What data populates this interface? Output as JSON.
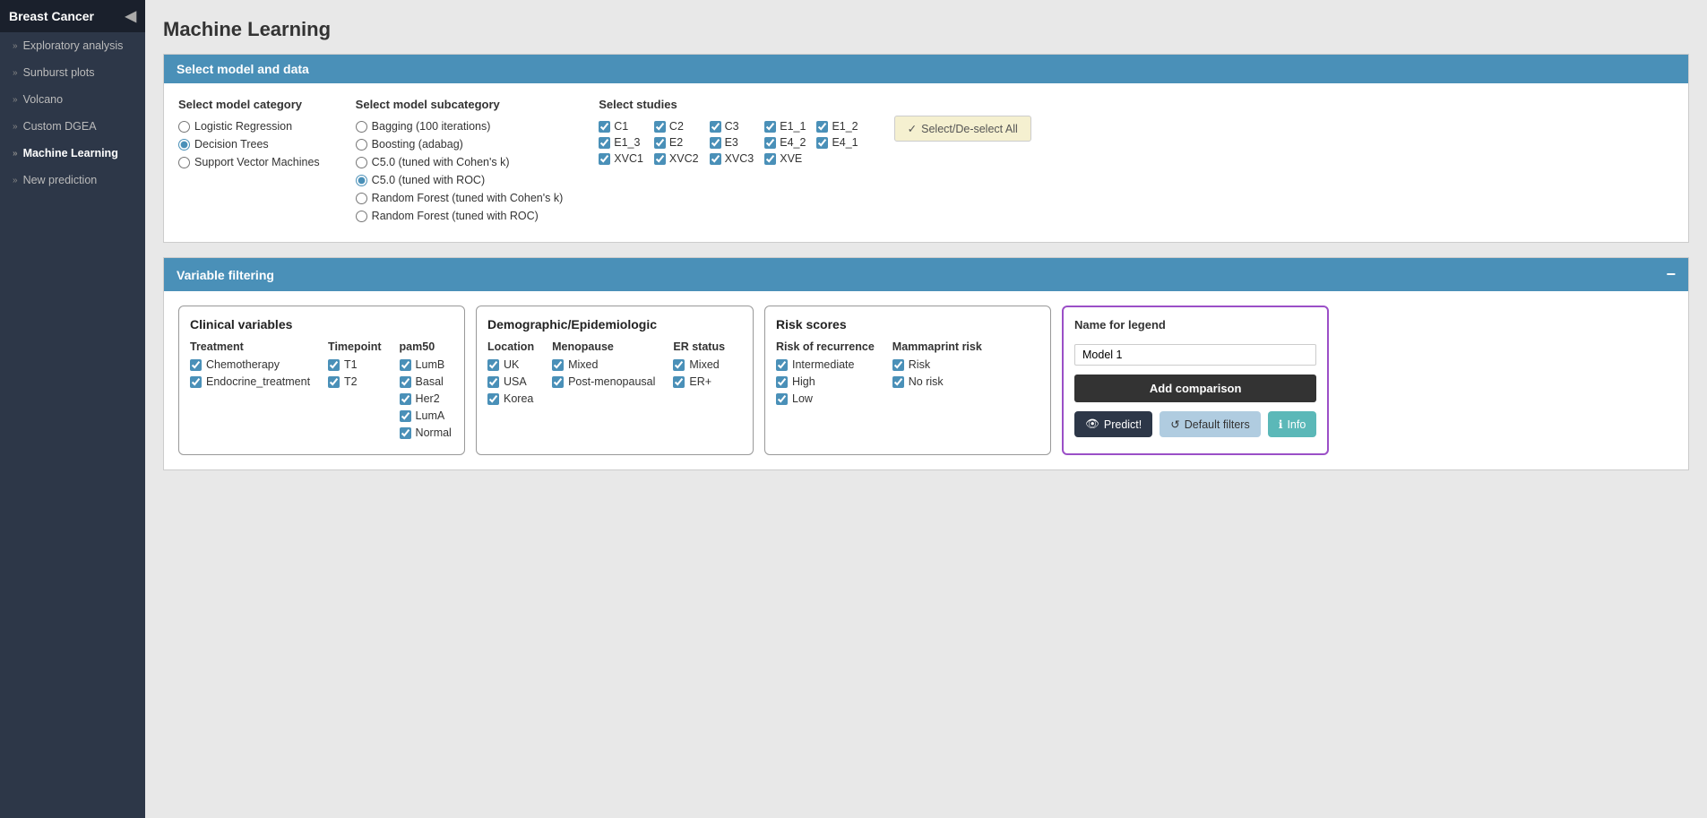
{
  "app": {
    "title": "Breast Cancer",
    "toggle_icon": "◀"
  },
  "sidebar": {
    "items": [
      {
        "id": "exploratory-analysis",
        "label": "Exploratory analysis",
        "active": false
      },
      {
        "id": "sunburst-plots",
        "label": "Sunburst plots",
        "active": false
      },
      {
        "id": "volcano",
        "label": "Volcano",
        "active": false
      },
      {
        "id": "custom-dgea",
        "label": "Custom DGEA",
        "active": false
      },
      {
        "id": "machine-learning",
        "label": "Machine Learning",
        "active": true
      },
      {
        "id": "new-prediction",
        "label": "New prediction",
        "active": false
      }
    ]
  },
  "page_title": "Machine Learning",
  "model_selection": {
    "panel_title": "Select model and data",
    "model_category": {
      "label": "Select model category",
      "options": [
        {
          "id": "logistic",
          "label": "Logistic Regression",
          "checked": false
        },
        {
          "id": "decision-trees",
          "label": "Decision Trees",
          "checked": true
        },
        {
          "id": "svm",
          "label": "Support Vector Machines",
          "checked": false
        }
      ]
    },
    "model_subcategory": {
      "label": "Select model subcategory",
      "options": [
        {
          "id": "bagging",
          "label": "Bagging (100 iterations)",
          "checked": false
        },
        {
          "id": "boosting",
          "label": "Boosting (adabag)",
          "checked": false
        },
        {
          "id": "c50-cohens",
          "label": "C5.0 (tuned with Cohen's k)",
          "checked": false
        },
        {
          "id": "c50-roc",
          "label": "C5.0 (tuned with ROC)",
          "checked": true
        },
        {
          "id": "rf-cohens",
          "label": "Random Forest (tuned with Cohen's k)",
          "checked": false
        },
        {
          "id": "rf-roc",
          "label": "Random Forest (tuned with ROC)",
          "checked": false
        }
      ]
    },
    "studies": {
      "label": "Select studies",
      "items": [
        {
          "id": "C1",
          "label": "C1",
          "checked": true
        },
        {
          "id": "C2",
          "label": "C2",
          "checked": true
        },
        {
          "id": "C3",
          "label": "C3",
          "checked": true
        },
        {
          "id": "E1_1",
          "label": "E1_1",
          "checked": true
        },
        {
          "id": "E1_2",
          "label": "E1_2",
          "checked": true
        },
        {
          "id": "E1_3",
          "label": "E1_3",
          "checked": true
        },
        {
          "id": "E2",
          "label": "E2",
          "checked": true
        },
        {
          "id": "E3",
          "label": "E3",
          "checked": true
        },
        {
          "id": "E4_2",
          "label": "E4_2",
          "checked": true
        },
        {
          "id": "E4_1",
          "label": "E4_1",
          "checked": true
        },
        {
          "id": "XVC1",
          "label": "XVC1",
          "checked": true
        },
        {
          "id": "XVC2",
          "label": "XVC2",
          "checked": true
        },
        {
          "id": "XVC3",
          "label": "XVC3",
          "checked": true
        },
        {
          "id": "XVE",
          "label": "XVE",
          "checked": true
        }
      ],
      "btn_label": "Select/De-select All",
      "btn_check_icon": "✓"
    }
  },
  "variable_filtering": {
    "panel_title": "Variable filtering",
    "collapse_icon": "−",
    "clinical": {
      "title": "Clinical variables",
      "treatment": {
        "header": "Treatment",
        "items": [
          {
            "label": "Chemotherapy",
            "checked": true
          },
          {
            "label": "Endocrine_treatment",
            "checked": true
          }
        ]
      },
      "timepoint": {
        "header": "Timepoint",
        "items": [
          {
            "label": "T1",
            "checked": true
          },
          {
            "label": "T2",
            "checked": true
          }
        ]
      },
      "pam50": {
        "header": "pam50",
        "items": [
          {
            "label": "LumB",
            "checked": true
          },
          {
            "label": "Basal",
            "checked": true
          },
          {
            "label": "Her2",
            "checked": true
          },
          {
            "label": "LumA",
            "checked": true
          },
          {
            "label": "Normal",
            "checked": true
          }
        ]
      }
    },
    "demographic": {
      "title": "Demographic/Epidemiologic",
      "location": {
        "header": "Location",
        "items": [
          {
            "label": "UK",
            "checked": true
          },
          {
            "label": "USA",
            "checked": true
          },
          {
            "label": "Korea",
            "checked": true
          }
        ]
      },
      "menopause": {
        "header": "Menopause",
        "items": [
          {
            "label": "Mixed",
            "checked": true
          },
          {
            "label": "Post-menopausal",
            "checked": true
          }
        ]
      },
      "er_status": {
        "header": "ER status",
        "items": [
          {
            "label": "Mixed",
            "checked": true
          },
          {
            "label": "ER+",
            "checked": true
          }
        ]
      }
    },
    "risk": {
      "title": "Risk scores",
      "recurrence": {
        "header": "Risk of recurrence",
        "items": [
          {
            "label": "Intermediate",
            "checked": true
          },
          {
            "label": "High",
            "checked": true
          },
          {
            "label": "Low",
            "checked": true
          }
        ]
      },
      "mammaprint": {
        "header": "Mammaprint risk",
        "items": [
          {
            "label": "Risk",
            "checked": true
          },
          {
            "label": "No risk",
            "checked": true
          }
        ]
      }
    },
    "legend": {
      "title": "Name for legend",
      "input_value": "Model 1",
      "add_comparison_label": "Add comparison",
      "predict_label": "Predict!",
      "default_filters_label": "Default filters",
      "info_label": "Info",
      "predict_icon": "👁",
      "default_icon": "↺",
      "info_icon": "ℹ"
    }
  }
}
